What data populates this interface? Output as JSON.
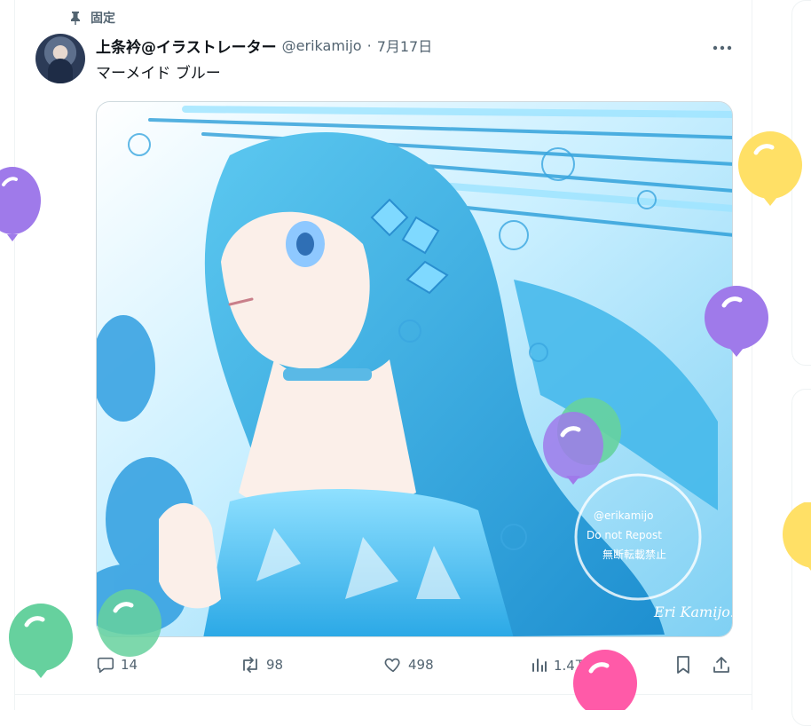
{
  "pinned_label": "固定",
  "author": {
    "name": "上条衿@イラストレーター",
    "handle": "@erikamijo",
    "separator": "·",
    "date": "7月17日"
  },
  "tweet_text": "マーメイド ブルー",
  "actions": {
    "replies": "14",
    "retweets": "98",
    "likes": "498",
    "views": "1.4万"
  },
  "artwork_signature": "Eri Kamijo.",
  "artwork_stamp": [
    "@erikamijo",
    "Do not Repost",
    "無断転載禁止"
  ],
  "colors": {
    "text_primary": "#0f1419",
    "text_secondary": "#536471",
    "border": "#cfd9de",
    "balloon_purple": "#9f7aea",
    "balloon_yellow": "#ffe066",
    "balloon_green": "#66d19e",
    "balloon_pink": "#ff5aa8"
  },
  "icons": [
    "pin-icon",
    "more-icon",
    "reply-icon",
    "retweet-icon",
    "like-icon",
    "views-icon",
    "bookmark-icon",
    "share-icon",
    "balloon-icon"
  ]
}
